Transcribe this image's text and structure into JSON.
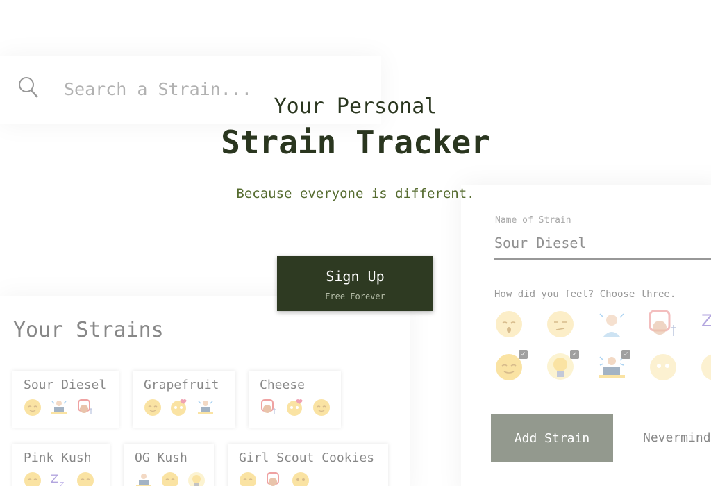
{
  "search": {
    "placeholder": "Search a Strain..."
  },
  "hero": {
    "subtitle": "Your Personal",
    "title": "Strain Tracker",
    "tagline": "Because everyone is different.",
    "signup_label": "Sign Up",
    "signup_sub": "Free Forever"
  },
  "strains": {
    "title": "Your Strains",
    "items": [
      {
        "name": "Sour Diesel",
        "icons": [
          "relaxed-face-icon",
          "working-person-icon",
          "hungry-person-icon"
        ]
      },
      {
        "name": "Grapefruit",
        "icons": [
          "relaxed-face-icon",
          "love-face-icon",
          "working-person-icon"
        ]
      },
      {
        "name": "Cheese",
        "icons": [
          "hungry-person-icon",
          "love-face-icon",
          "relaxed-face-icon"
        ]
      },
      {
        "name": "Pink Kush",
        "icons": [
          "relaxed-face-icon",
          "sleepy-zzz-icon",
          "relaxed-face-icon"
        ]
      },
      {
        "name": "OG Kush",
        "icons": [
          "working-person-icon",
          "relaxed-face-icon",
          "lightbulb-icon"
        ]
      },
      {
        "name": "Girl Scout Cookies",
        "icons": [
          "relaxed-face-icon",
          "hungry-person-icon",
          "neutral-face-icon"
        ]
      }
    ]
  },
  "form": {
    "name_label": "Name of Strain",
    "name_value": "Sour Diesel",
    "feel_label": "How did you feel? Choose three.",
    "add_label": "Add Strain",
    "nevermind_label": "Nevermind"
  },
  "colors": {
    "brand_dark": "#2e3a22",
    "accent_green": "#556b2f",
    "emoji_yellow": "#f6c94a"
  }
}
